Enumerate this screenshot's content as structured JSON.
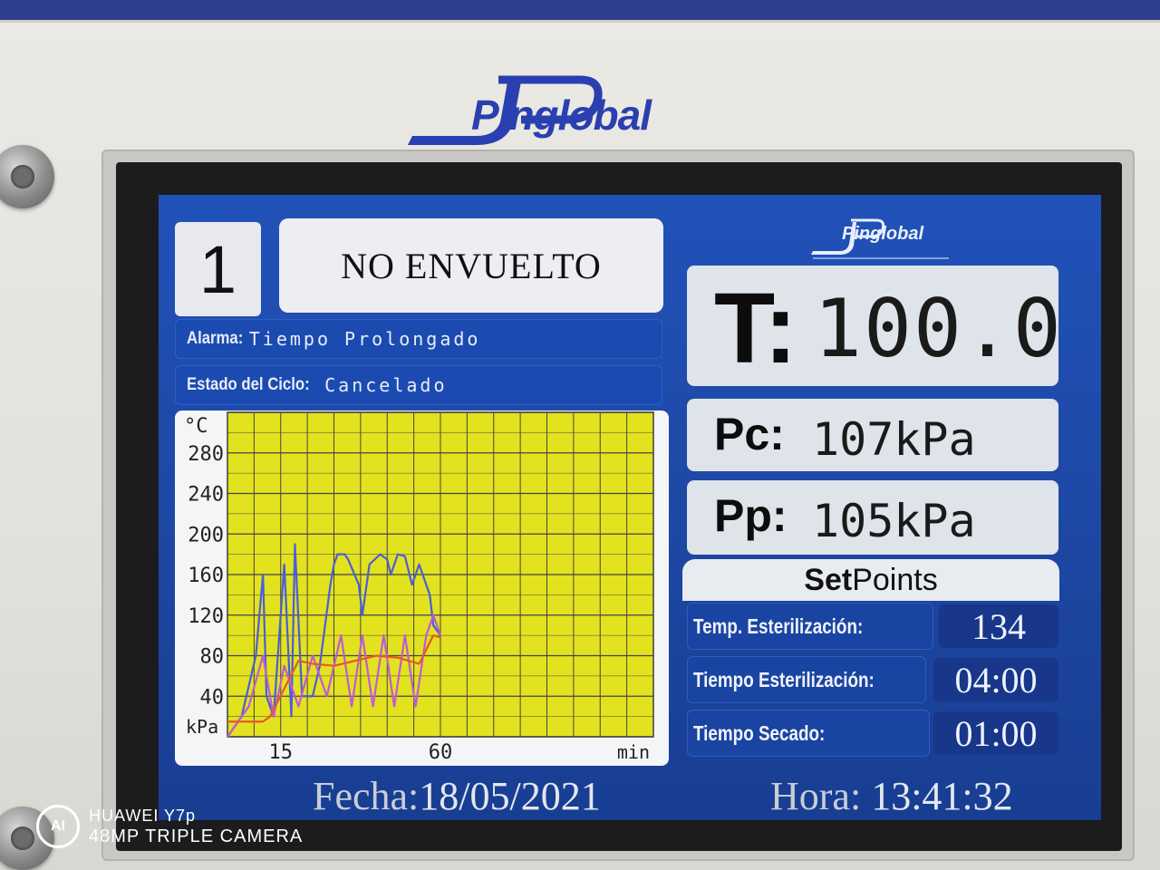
{
  "device": {
    "brand": "Pinglobal",
    "watermark": {
      "badge": "AI",
      "line1": "HUAWEI Y7p",
      "line2": "48MP TRIPLE CAMERA"
    }
  },
  "header": {
    "cycle_number": "1",
    "program": "NO ENVUELTO",
    "logo_text": "Pinglobal"
  },
  "status": {
    "alarm_label": "Alarma:",
    "alarm_value": "Tiempo Prolongado",
    "state_label": "Estado del Ciclo:",
    "state_value": "Cancelado"
  },
  "readouts": {
    "t_label": "T:",
    "t_value": "100.0",
    "pc_label": "Pc:",
    "pc_value": "107kPa",
    "pp_label": "Pp:",
    "pp_value": "105kPa"
  },
  "setpoints": {
    "title_bold": "Set",
    "title_rest": "Points",
    "temp_label": "Temp. Esterilización:",
    "temp_value": "134",
    "ster_time_label": "Tiempo Esterilización:",
    "ster_time_value": "04:00",
    "dry_time_label": "Tiempo Secado:",
    "dry_time_value": "01:00"
  },
  "footer": {
    "date_label": "Fecha:",
    "date_value": "18/05/2021",
    "time_label": "Hora:",
    "time_value": "13:41:32"
  },
  "colors": {
    "screen_bg": "#1f49a8",
    "plot_bg": "#e2e21f",
    "temperature_line": "#e35a2a",
    "pressure_line": "#c05ad6",
    "pressure2_line": "#4a5ed8"
  },
  "chart_data": {
    "type": "line",
    "y_unit_top": "°C",
    "y_unit_bottom": "kPa",
    "x_unit": "min",
    "y_ticks": [
      280,
      240,
      200,
      160,
      120,
      80,
      40
    ],
    "x_ticks": [
      15,
      60
    ],
    "ylim": [
      0,
      320
    ],
    "xlim": [
      0,
      120
    ],
    "grid": true,
    "series": [
      {
        "color": "#4a5ed8",
        "x": [
          0,
          4,
          8,
          10,
          11,
          13,
          16,
          18,
          19,
          21,
          24,
          26,
          29,
          30,
          31,
          33,
          34,
          37,
          38,
          40,
          43,
          45,
          46,
          48,
          50,
          52,
          54,
          55,
          57,
          58,
          60
        ],
        "y": [
          0,
          20,
          80,
          160,
          40,
          20,
          170,
          20,
          190,
          40,
          40,
          70,
          150,
          170,
          180,
          180,
          175,
          150,
          120,
          170,
          180,
          175,
          160,
          180,
          178,
          150,
          170,
          160,
          140,
          110,
          100
        ]
      },
      {
        "color": "#c05ad6",
        "x": [
          0,
          6,
          10,
          13,
          16,
          20,
          24,
          28,
          32,
          35,
          38,
          41,
          44,
          47,
          50,
          53,
          56,
          58,
          60
        ],
        "y": [
          0,
          30,
          80,
          20,
          70,
          30,
          80,
          40,
          100,
          30,
          100,
          30,
          100,
          30,
          100,
          30,
          100,
          120,
          100
        ]
      },
      {
        "color": "#e35a2a",
        "x": [
          0,
          5,
          10,
          12,
          20,
          24,
          30,
          36,
          42,
          48,
          54,
          58,
          60
        ],
        "y": [
          15,
          15,
          15,
          20,
          75,
          72,
          70,
          75,
          80,
          78,
          72,
          100,
          98
        ]
      }
    ]
  }
}
